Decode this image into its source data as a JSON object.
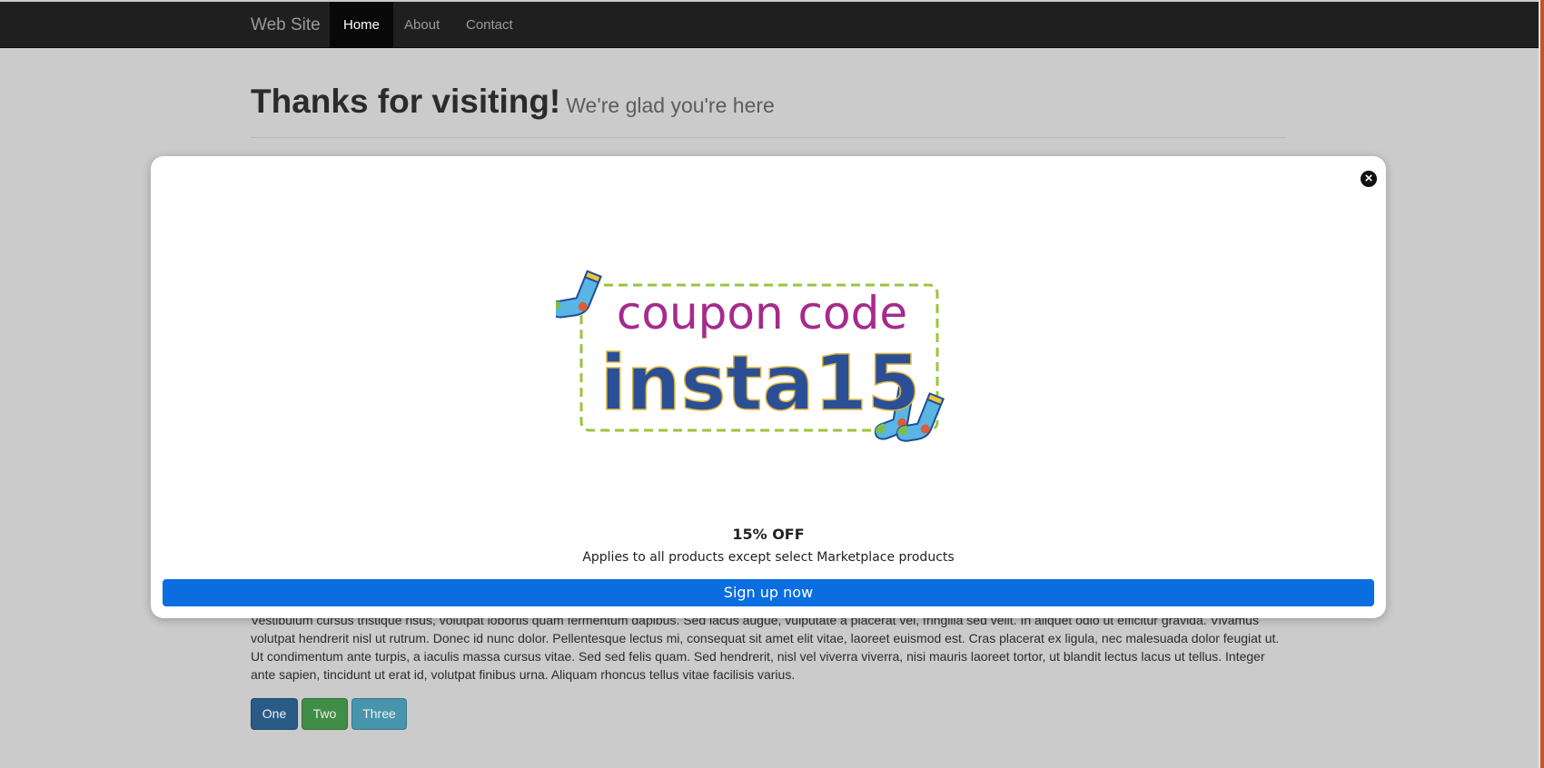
{
  "navbar": {
    "brand": "Web Site",
    "items": [
      {
        "label": "Home",
        "active": true
      },
      {
        "label": "About",
        "active": false
      },
      {
        "label": "Contact",
        "active": false
      }
    ]
  },
  "header": {
    "title": "Thanks for visiting!",
    "subtitle": "We're glad you're here"
  },
  "content": {
    "paragraph": "Vestibulum cursus tristique risus, volutpat lobortis quam fermentum dapibus. Sed lacus augue, vulputate a placerat vel, fringilla sed velit. In aliquet odio ut efficitur gravida. Vivamus volutpat hendrerit nisl ut rutrum. Donec id nunc dolor. Pellentesque lectus mi, consequat sit amet elit vitae, laoreet euismod est. Cras placerat ex ligula, nec malesuada dolor feugiat ut. Ut condimentum ante turpis, a iaculis massa cursus vitae. Sed sed felis quam. Sed hendrerit, nisl vel viverra viverra, nisi mauris laoreet tortor, ut blandit lectus lacus ut tellus. Integer ante sapien, tincidunt ut erat id, volutpat finibus urna. Aliquam rhoncus tellus vitae facilisis varius.",
    "buttons": [
      "One",
      "Two",
      "Three"
    ]
  },
  "modal": {
    "close_icon": "close-circle-icon",
    "coupon_heading": "coupon code",
    "coupon_code": "insta15",
    "offer_title": "15% OFF",
    "offer_subtitle": "Applies to all products except select Marketplace products",
    "cta_label": "Sign up now"
  },
  "colors": {
    "navbar_bg": "#1f1f1f",
    "overlay_bg": "#cbcbcb",
    "cta_blue": "#0a6ee0",
    "coupon_heading": "#a62a8d",
    "coupon_code": "#2b4f97",
    "coupon_border": "#9bc53d",
    "btn_one": "#2a5b86",
    "btn_two": "#3f8d46",
    "btn_three": "#4795ad"
  }
}
